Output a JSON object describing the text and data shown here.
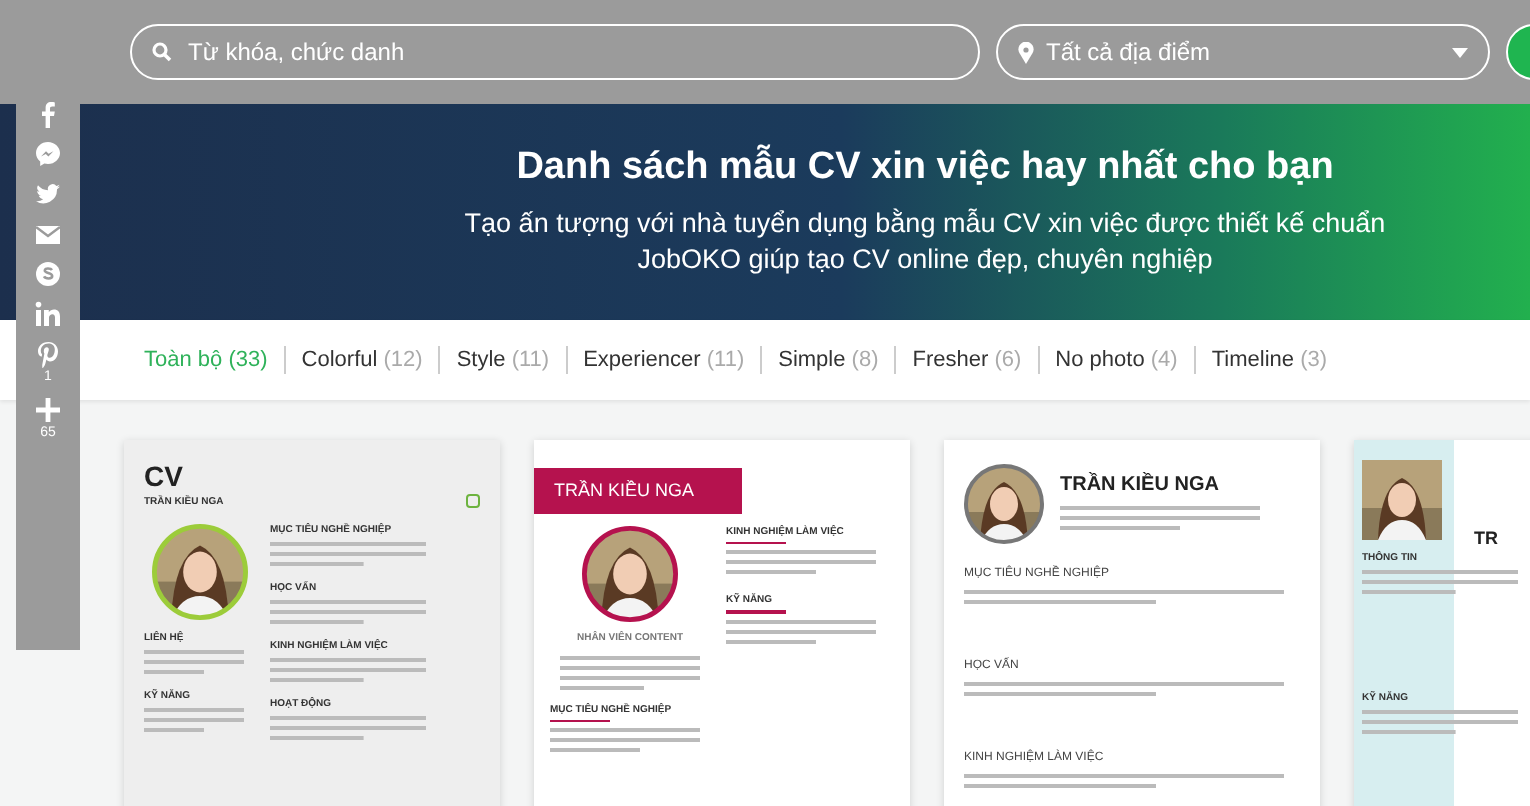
{
  "search": {
    "placeholder": "Từ khóa, chức danh"
  },
  "location": {
    "value": "Tất cả địa điểm"
  },
  "share_bar": {
    "pin_count": "1",
    "more_count": "65"
  },
  "banner": {
    "title": "Danh sách mẫu CV xin việc hay nhất cho bạn",
    "subtitle_lines": [
      "Tạo ấn tượng với nhà tuyển dụng bằng mẫu CV xin việc được thiết kế chuẩn",
      "JobOKO giúp tạo CV online đẹp, chuyên nghiệp"
    ]
  },
  "filters": [
    {
      "label": "Toàn bộ",
      "count": "(33)",
      "selected": true
    },
    {
      "label": "Colorful",
      "count": "(12)",
      "selected": false
    },
    {
      "label": "Style",
      "count": "(11)",
      "selected": false
    },
    {
      "label": "Experiencer",
      "count": "(11)",
      "selected": false
    },
    {
      "label": "Simple",
      "count": "(8)",
      "selected": false
    },
    {
      "label": "Fresher",
      "count": "(6)",
      "selected": false
    },
    {
      "label": "No photo",
      "count": "(4)",
      "selected": false
    },
    {
      "label": "Timeline",
      "count": "(3)",
      "selected": false
    }
  ],
  "templates": [
    {
      "kind": "green",
      "heading": "CV",
      "name": "TRẦN KIỀU NGA",
      "left_sections": [
        "LIÊN HỆ",
        "KỸ NĂNG"
      ],
      "right_sections": [
        "MỤC TIÊU NGHỀ NGHIỆP",
        "HỌC VẤN",
        "KINH NGHIỆM LÀM VIỆC",
        "HOẠT ĐỘNG"
      ]
    },
    {
      "kind": "red",
      "name": "TRẦN KIỀU NGA",
      "role": "NHÂN VIÊN CONTENT",
      "left_sections": [
        "MỤC TIÊU NGHỀ NGHIỆP"
      ],
      "right_sections": [
        "KINH NGHIỆM LÀM VIỆC",
        "KỸ NĂNG"
      ]
    },
    {
      "kind": "plain",
      "name": "TRẦN KIỀU NGA",
      "right_sections": [
        "MỤC TIÊU NGHỀ NGHIỆP",
        "HỌC VẤN",
        "KINH NGHIỆM LÀM VIỆC"
      ]
    },
    {
      "kind": "blue",
      "name": "TR",
      "left_sections": [
        "THÔNG TIN",
        "KỸ NĂNG"
      ]
    }
  ]
}
